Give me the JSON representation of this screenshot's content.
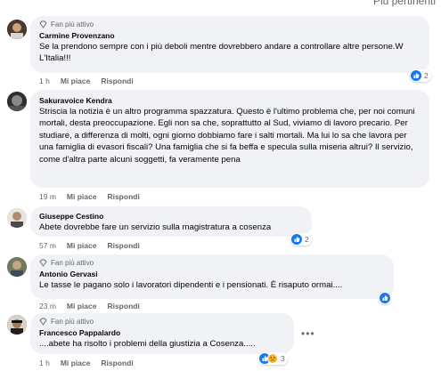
{
  "header": {
    "sort_label": "Più pertinenti"
  },
  "comments": [
    {
      "badge": "Fan più attivo",
      "author": "Carmine Provenzano",
      "text": "Se la prendono sempre con i più deboli mentre dovrebbero andare a controllare altre persone.W L'Italia!!!",
      "time": "1 h",
      "like": "Mi piace",
      "reply": "Rispondi",
      "reactions": "2",
      "reaction_icons": [
        "like-icon"
      ]
    },
    {
      "badge": "",
      "author": "Sakuravoice Kendra",
      "text": "Striscia la notizia è un altro programma spazzatura. Questo è l'ultimo problema che, per noi comuni mortali, desta preoccupazione. Egli non sa che, soprattutto al Sud, viviamo di lavoro precario. Per studiare, a differenza di molti, ogni giorno dobbiamo fare i salti mortali. Ma lui lo sa che lavora per una famiglia di evasori fiscali? Una famiglia che si fa beffa e specula sulla miseria altrui? Il servizio, come d'altra parte alcuni soggetti, fa veramente pena",
      "time": "19 m",
      "like": "Mi piace",
      "reply": "Rispondi",
      "reactions": "",
      "reaction_icons": []
    },
    {
      "badge": "",
      "author": "Giuseppe Cestino",
      "text": "Abete dovrebbe fare un servizio sulla magistratura a cosenza",
      "time": "57 m",
      "like": "Mi piace",
      "reply": "Rispondi",
      "reactions": "2",
      "reaction_icons": [
        "like-icon"
      ]
    },
    {
      "badge": "Fan più attivo",
      "author": "Antonio Gervasi",
      "text": "Le tasse le pagano solo i lavoratori dipendenti e i pensionati. È risaputo ormai....",
      "time": "23 m",
      "like": "Mi piace",
      "reply": "Rispondi",
      "reactions": "",
      "reaction_icons": [
        "like-icon"
      ]
    },
    {
      "badge": "Fan più attivo",
      "author": "Francesco Pappalardo",
      "text": "....abete ha risolto i problemi della giustizia a Cosenza.....",
      "time": "1 h",
      "like": "Mi piace",
      "reply": "Rispondi",
      "reactions": "3",
      "reaction_icons": [
        "like-icon",
        "sad-icon"
      ],
      "more": "•••"
    }
  ],
  "colors": {
    "like_blue": "#1877f2",
    "sad_yellow": "#f7b125",
    "bubble_bg": "#f0f2f5",
    "meta_grey": "#65676b"
  }
}
